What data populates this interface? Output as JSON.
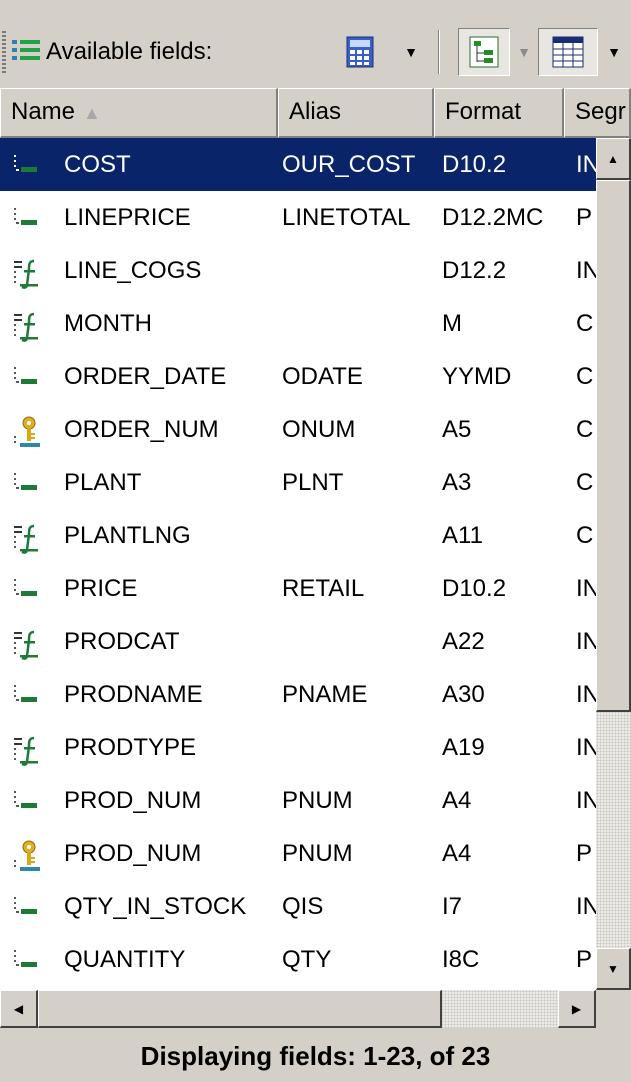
{
  "toolbar": {
    "title": "Available fields:",
    "icons": [
      "fields-list-icon",
      "calculator-icon",
      "tree-view-icon",
      "grid-view-icon"
    ]
  },
  "columns": [
    "Name",
    "Alias",
    "Format",
    "Segr"
  ],
  "sort_indicator": "▲",
  "rows": [
    {
      "icon": "field-icon",
      "name": "COST",
      "alias": "OUR_COST",
      "format": "D10.2",
      "seg": "IN",
      "selected": true
    },
    {
      "icon": "field-icon",
      "name": "LINEPRICE",
      "alias": "LINETOTAL",
      "format": "D12.2MC",
      "seg": "P"
    },
    {
      "icon": "computed-field-icon",
      "name": "LINE_COGS",
      "alias": "",
      "format": "D12.2",
      "seg": "IN"
    },
    {
      "icon": "computed-field-icon",
      "name": "MONTH",
      "alias": "",
      "format": "M",
      "seg": "C"
    },
    {
      "icon": "field-icon",
      "name": "ORDER_DATE",
      "alias": "ODATE",
      "format": "YYMD",
      "seg": "C"
    },
    {
      "icon": "key-field-icon",
      "name": "ORDER_NUM",
      "alias": "ONUM",
      "format": "A5",
      "seg": "C"
    },
    {
      "icon": "field-icon",
      "name": "PLANT",
      "alias": "PLNT",
      "format": "A3",
      "seg": "C"
    },
    {
      "icon": "computed-field-icon",
      "name": "PLANTLNG",
      "alias": "",
      "format": "A11",
      "seg": "C"
    },
    {
      "icon": "field-icon",
      "name": "PRICE",
      "alias": "RETAIL",
      "format": "D10.2",
      "seg": "IN"
    },
    {
      "icon": "computed-field-icon",
      "name": "PRODCAT",
      "alias": "",
      "format": "A22",
      "seg": "IN"
    },
    {
      "icon": "field-icon",
      "name": "PRODNAME",
      "alias": "PNAME",
      "format": "A30",
      "seg": "IN"
    },
    {
      "icon": "computed-field-icon",
      "name": "PRODTYPE",
      "alias": "",
      "format": "A19",
      "seg": "IN"
    },
    {
      "icon": "field-icon",
      "name": "PROD_NUM",
      "alias": "PNUM",
      "format": "A4",
      "seg": "IN"
    },
    {
      "icon": "key-field-icon",
      "name": "PROD_NUM",
      "alias": "PNUM",
      "format": "A4",
      "seg": "P"
    },
    {
      "icon": "field-icon",
      "name": "QTY_IN_STOCK",
      "alias": "QIS",
      "format": "I7",
      "seg": "IN"
    },
    {
      "icon": "field-icon",
      "name": "QUANTITY",
      "alias": "QTY",
      "format": "I8C",
      "seg": "P"
    }
  ],
  "status": "Displaying fields: 1-23, of 23",
  "colors": {
    "selection": "#0a246a",
    "face": "#d4d0c8"
  }
}
